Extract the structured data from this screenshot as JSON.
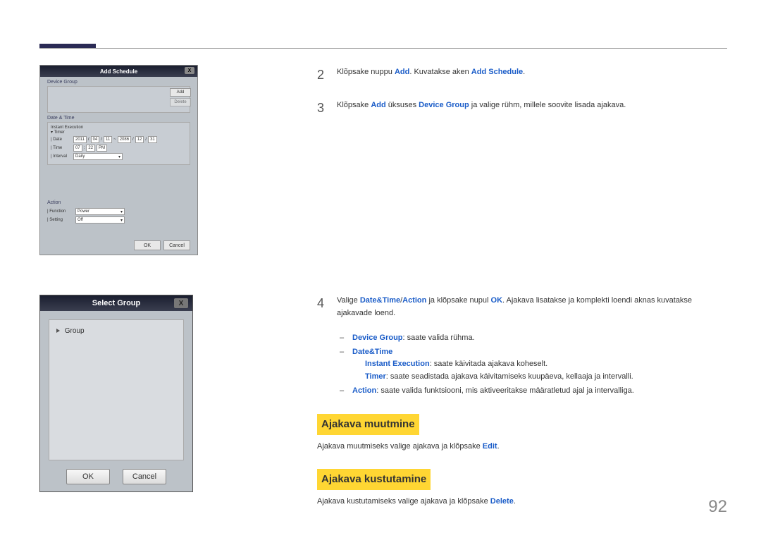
{
  "add_schedule_dialog": {
    "title": "Add Schedule",
    "close": "X",
    "device_group_label": "Device Group",
    "add_btn": "Add",
    "delete_btn": "Delete",
    "datetime_label": "Date & Time",
    "instant_exec": "Instant Execution",
    "timer_label": "▾ Timer",
    "date_label": "| Date",
    "date_val1": "2011",
    "date_val2": "04",
    "date_val3": "11",
    "date_to": "~",
    "date_val4": "2086",
    "date_val5": "12",
    "date_val6": "31",
    "time_label": "| Time",
    "time_h": "07",
    "time_m": "22",
    "time_ampm": "PM",
    "interval_label": "| Interval",
    "interval_val": "Daily",
    "action_label": "Action",
    "function_label": "| Function",
    "function_val": "Power",
    "setting_label": "| Setting",
    "setting_val": "Off",
    "ok": "OK",
    "cancel": "Cancel"
  },
  "select_group_dialog": {
    "title": "Select Group",
    "close": "X",
    "tree_root": "Group",
    "ok": "OK",
    "cancel": "Cancel"
  },
  "steps": {
    "s2_num": "2",
    "s2_t1": "Klõpsake nuppu ",
    "s2_kw1": "Add",
    "s2_t2": ". Kuvatakse aken ",
    "s2_kw2": "Add Schedule",
    "s2_t3": ".",
    "s3_num": "3",
    "s3_t1": "Klõpsake ",
    "s3_kw1": "Add",
    "s3_t2": " üksuses ",
    "s3_kw2": "Device Group",
    "s3_t3": " ja valige rühm, millele soovite lisada ajakava.",
    "s4_num": "4",
    "s4_t1": "Valige ",
    "s4_kw1": "Date&Time",
    "s4_sep": "/",
    "s4_kw2": "Action",
    "s4_t2": " ja klõpsake nupul ",
    "s4_kw3": "OK",
    "s4_t3": ". Ajakava lisatakse ja komplekti loendi aknas kuvatakse ajakavade loend."
  },
  "sub": {
    "dash": "‒",
    "dg_kw": "Device Group",
    "dg_t": ": saate valida rühma.",
    "dt_kw": "Date&Time",
    "ie_kw": "Instant Execution",
    "ie_t": ": saate käivitada ajakava koheselt.",
    "tm_kw": "Timer",
    "tm_t": ": saate seadistada ajakava käivitamiseks kuupäeva, kellaaja ja intervalli.",
    "ac_kw": "Action",
    "ac_t": ": saate valida funktsiooni, mis aktiveeritakse määratletud ajal ja intervalliga."
  },
  "headings": {
    "edit_title": "Ajakava muutmine",
    "edit_t1": "Ajakava muutmiseks valige ajakava ja klõpsake ",
    "edit_kw": "Edit",
    "edit_t2": ".",
    "del_title": "Ajakava kustutamine",
    "del_t1": "Ajakava kustutamiseks valige ajakava ja klõpsake ",
    "del_kw": "Delete",
    "del_t2": "."
  },
  "page_number": "92"
}
